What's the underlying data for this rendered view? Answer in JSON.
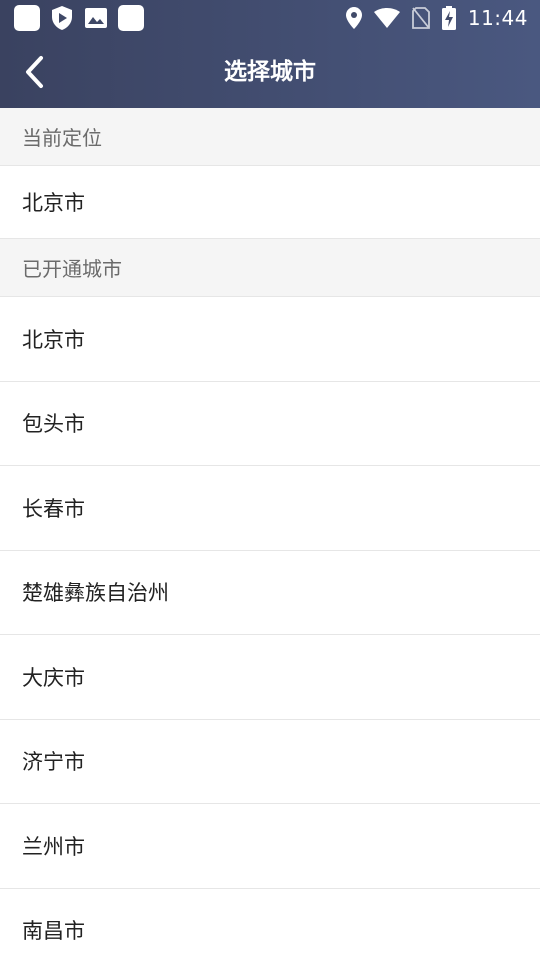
{
  "status_bar": {
    "time": "11:44",
    "left_icons": [
      "app-square-icon",
      "shield-icon",
      "image-icon",
      "app-square-icon"
    ],
    "right_icons": [
      "location-icon",
      "wifi-icon",
      "no-sim-icon",
      "battery-charging-icon"
    ]
  },
  "app_bar": {
    "title": "选择城市",
    "back_icon": "chevron-left-icon"
  },
  "current_location": {
    "header": "当前定位",
    "city": "北京市"
  },
  "open_cities": {
    "header": "已开通城市",
    "items": [
      "北京市",
      "包头市",
      "长春市",
      "楚雄彝族自治州",
      "大庆市",
      "济宁市",
      "兰州市",
      "南昌市"
    ]
  },
  "colors": {
    "top_gradient_start": "#3a4260",
    "top_gradient_end": "#4a5880",
    "section_bg": "#f5f5f5",
    "divider": "#e6e6e6"
  }
}
